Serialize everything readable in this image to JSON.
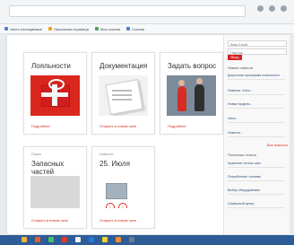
{
  "browser": {
    "bookmarks": [
      "Часто посещаемые",
      "Начальная страница",
      "Мои ссылки",
      "Ссылки"
    ]
  },
  "cards": {
    "loyalty": {
      "title": "Лояльности",
      "link": "Подробнее"
    },
    "documentation": {
      "title": "Документация",
      "link": "Открыть в новом окне"
    },
    "question": {
      "title": "Задать вопрос",
      "link": "Подробнее"
    },
    "parts": {
      "subtitle": "Поиск",
      "title": "Запасных частей",
      "link": "Открыть в новом окне"
    },
    "news": {
      "subtitle": "Новости",
      "title": "25. Июля",
      "link": "Открыть в новом окне"
    }
  },
  "sidebar": {
    "login_placeholder": "Ваш Email",
    "password_placeholder": "Пароль",
    "login_button": "Вход",
    "section1": "Новые новости",
    "links1": [
      "Досрочная программа лояльности",
      "Новинка. Volvo...",
      "Новые модели...",
      "Volvo...",
      "Новости..."
    ],
    "more1": "Все новости",
    "section2": "Полезные статьи",
    "links2": [
      "Хранение летних шин",
      "Потребление топлива",
      "Выбор оборудования",
      "Сервисный центр"
    ]
  }
}
